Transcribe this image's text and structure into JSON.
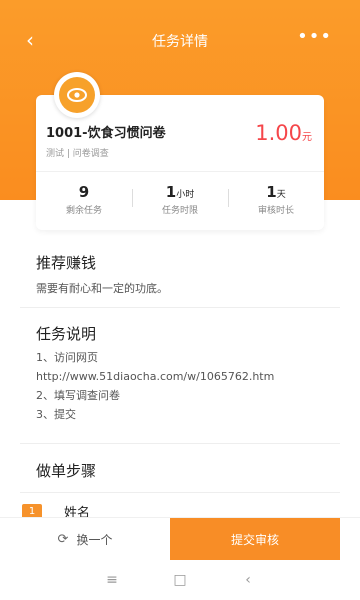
{
  "header": {
    "title": "任务详情",
    "back_icon": "‹",
    "more_icon": "•••"
  },
  "task": {
    "title": "1001-饮食习惯问卷",
    "meta": "测试 | 问卷调查",
    "price": "1.00",
    "price_unit": "元",
    "stats": [
      {
        "value": "9",
        "unit": "",
        "label": "剩余任务"
      },
      {
        "value": "1",
        "unit": "小时",
        "label": "任务时限"
      },
      {
        "value": "1",
        "unit": "天",
        "label": "审核时长"
      }
    ]
  },
  "recommend": {
    "title": "推荐赚钱",
    "text": "需要有耐心和一定的功底。"
  },
  "description": {
    "title": "任务说明",
    "lines": [
      "1、访问网页",
      "http://www.51diaocha.com/w/1065762.htm",
      "2、填写调查问卷",
      "3、提交"
    ]
  },
  "steps": {
    "title": "做单步骤",
    "items": [
      {
        "badge": "1",
        "label": "姓名"
      }
    ]
  },
  "bottom": {
    "change_label": "换一个",
    "submit_label": "提交审核"
  },
  "colors": {
    "brand_orange": "#fa8d1f",
    "price_red": "#f5464a"
  }
}
